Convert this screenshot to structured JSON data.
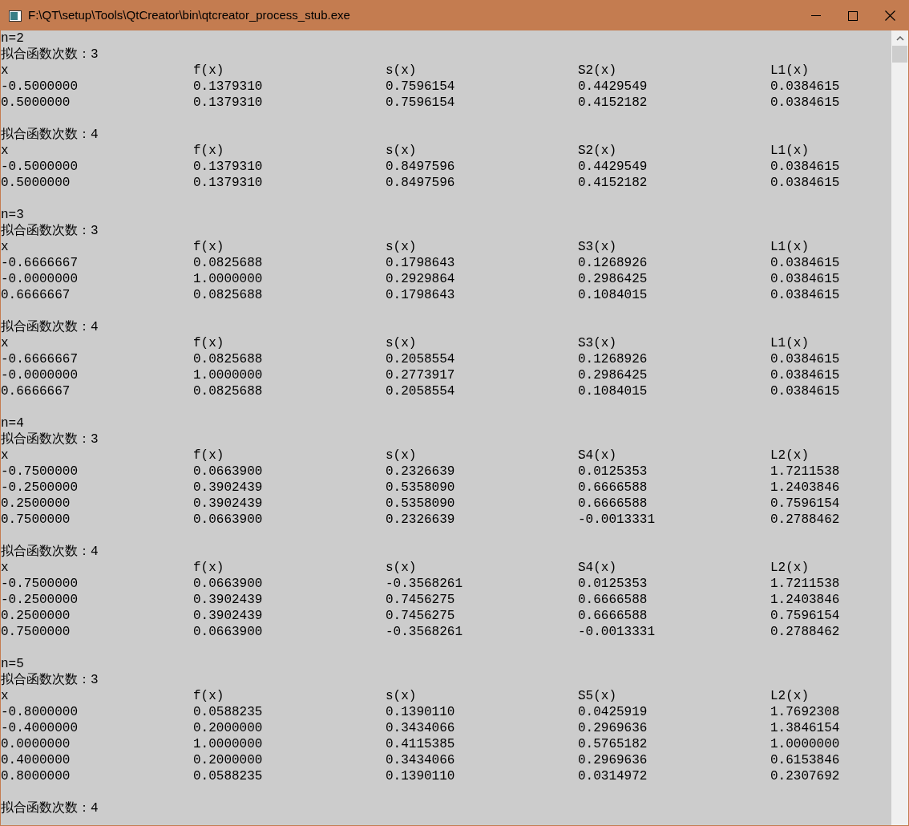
{
  "window": {
    "title": "F:\\QT\\setup\\Tools\\QtCreator\\bin\\qtcreator_process_stub.exe"
  },
  "console": {
    "lines": [
      {
        "kind": "text",
        "text": "n=2"
      },
      {
        "kind": "text",
        "text": "拟合函数次数：3"
      },
      {
        "kind": "row",
        "cells": [
          "x",
          "f(x)",
          "s(x)",
          "S2(x)",
          "L1(x)"
        ]
      },
      {
        "kind": "row",
        "cells": [
          "-0.5000000",
          "0.1379310",
          "0.7596154",
          "0.4429549",
          "0.0384615"
        ]
      },
      {
        "kind": "row",
        "cells": [
          "0.5000000",
          "0.1379310",
          "0.7596154",
          "0.4152182",
          "0.0384615"
        ]
      },
      {
        "kind": "blank"
      },
      {
        "kind": "text",
        "text": "拟合函数次数：4"
      },
      {
        "kind": "row",
        "cells": [
          "x",
          "f(x)",
          "s(x)",
          "S2(x)",
          "L1(x)"
        ]
      },
      {
        "kind": "row",
        "cells": [
          "-0.5000000",
          "0.1379310",
          "0.8497596",
          "0.4429549",
          "0.0384615"
        ]
      },
      {
        "kind": "row",
        "cells": [
          "0.5000000",
          "0.1379310",
          "0.8497596",
          "0.4152182",
          "0.0384615"
        ]
      },
      {
        "kind": "blank"
      },
      {
        "kind": "text",
        "text": "n=3"
      },
      {
        "kind": "text",
        "text": "拟合函数次数：3"
      },
      {
        "kind": "row",
        "cells": [
          "x",
          "f(x)",
          "s(x)",
          "S3(x)",
          "L1(x)"
        ]
      },
      {
        "kind": "row",
        "cells": [
          "-0.6666667",
          "0.0825688",
          "0.1798643",
          "0.1268926",
          "0.0384615"
        ]
      },
      {
        "kind": "row",
        "cells": [
          "-0.0000000",
          "1.0000000",
          "0.2929864",
          "0.2986425",
          "0.0384615"
        ]
      },
      {
        "kind": "row",
        "cells": [
          "0.6666667",
          "0.0825688",
          "0.1798643",
          "0.1084015",
          "0.0384615"
        ]
      },
      {
        "kind": "blank"
      },
      {
        "kind": "text",
        "text": "拟合函数次数：4"
      },
      {
        "kind": "row",
        "cells": [
          "x",
          "f(x)",
          "s(x)",
          "S3(x)",
          "L1(x)"
        ]
      },
      {
        "kind": "row",
        "cells": [
          "-0.6666667",
          "0.0825688",
          "0.2058554",
          "0.1268926",
          "0.0384615"
        ]
      },
      {
        "kind": "row",
        "cells": [
          "-0.0000000",
          "1.0000000",
          "0.2773917",
          "0.2986425",
          "0.0384615"
        ]
      },
      {
        "kind": "row",
        "cells": [
          "0.6666667",
          "0.0825688",
          "0.2058554",
          "0.1084015",
          "0.0384615"
        ]
      },
      {
        "kind": "blank"
      },
      {
        "kind": "text",
        "text": "n=4"
      },
      {
        "kind": "text",
        "text": "拟合函数次数：3"
      },
      {
        "kind": "row",
        "cells": [
          "x",
          "f(x)",
          "s(x)",
          "S4(x)",
          "L2(x)"
        ]
      },
      {
        "kind": "row",
        "cells": [
          "-0.7500000",
          "0.0663900",
          "0.2326639",
          "0.0125353",
          "1.7211538"
        ]
      },
      {
        "kind": "row",
        "cells": [
          "-0.2500000",
          "0.3902439",
          "0.5358090",
          "0.6666588",
          "1.2403846"
        ]
      },
      {
        "kind": "row",
        "cells": [
          "0.2500000",
          "0.3902439",
          "0.5358090",
          "0.6666588",
          "0.7596154"
        ]
      },
      {
        "kind": "row",
        "cells": [
          "0.7500000",
          "0.0663900",
          "0.2326639",
          "-0.0013331",
          "0.2788462"
        ]
      },
      {
        "kind": "blank"
      },
      {
        "kind": "text",
        "text": "拟合函数次数：4"
      },
      {
        "kind": "row",
        "cells": [
          "x",
          "f(x)",
          "s(x)",
          "S4(x)",
          "L2(x)"
        ]
      },
      {
        "kind": "row",
        "cells": [
          "-0.7500000",
          "0.0663900",
          "-0.3568261",
          "0.0125353",
          "1.7211538"
        ]
      },
      {
        "kind": "row",
        "cells": [
          "-0.2500000",
          "0.3902439",
          "0.7456275",
          "0.6666588",
          "1.2403846"
        ]
      },
      {
        "kind": "row",
        "cells": [
          "0.2500000",
          "0.3902439",
          "0.7456275",
          "0.6666588",
          "0.7596154"
        ]
      },
      {
        "kind": "row",
        "cells": [
          "0.7500000",
          "0.0663900",
          "-0.3568261",
          "-0.0013331",
          "0.2788462"
        ]
      },
      {
        "kind": "blank"
      },
      {
        "kind": "text",
        "text": "n=5"
      },
      {
        "kind": "text",
        "text": "拟合函数次数：3"
      },
      {
        "kind": "row",
        "cells": [
          "x",
          "f(x)",
          "s(x)",
          "S5(x)",
          "L2(x)"
        ]
      },
      {
        "kind": "row",
        "cells": [
          "-0.8000000",
          "0.0588235",
          "0.1390110",
          "0.0425919",
          "1.7692308"
        ]
      },
      {
        "kind": "row",
        "cells": [
          "-0.4000000",
          "0.2000000",
          "0.3434066",
          "0.2969636",
          "1.3846154"
        ]
      },
      {
        "kind": "row",
        "cells": [
          "0.0000000",
          "1.0000000",
          "0.4115385",
          "0.5765182",
          "1.0000000"
        ]
      },
      {
        "kind": "row",
        "cells": [
          "0.4000000",
          "0.2000000",
          "0.3434066",
          "0.2969636",
          "0.6153846"
        ]
      },
      {
        "kind": "row",
        "cells": [
          "0.8000000",
          "0.0588235",
          "0.1390110",
          "0.0314972",
          "0.2307692"
        ]
      },
      {
        "kind": "blank"
      },
      {
        "kind": "text",
        "text": "拟合函数次数：4"
      }
    ]
  }
}
